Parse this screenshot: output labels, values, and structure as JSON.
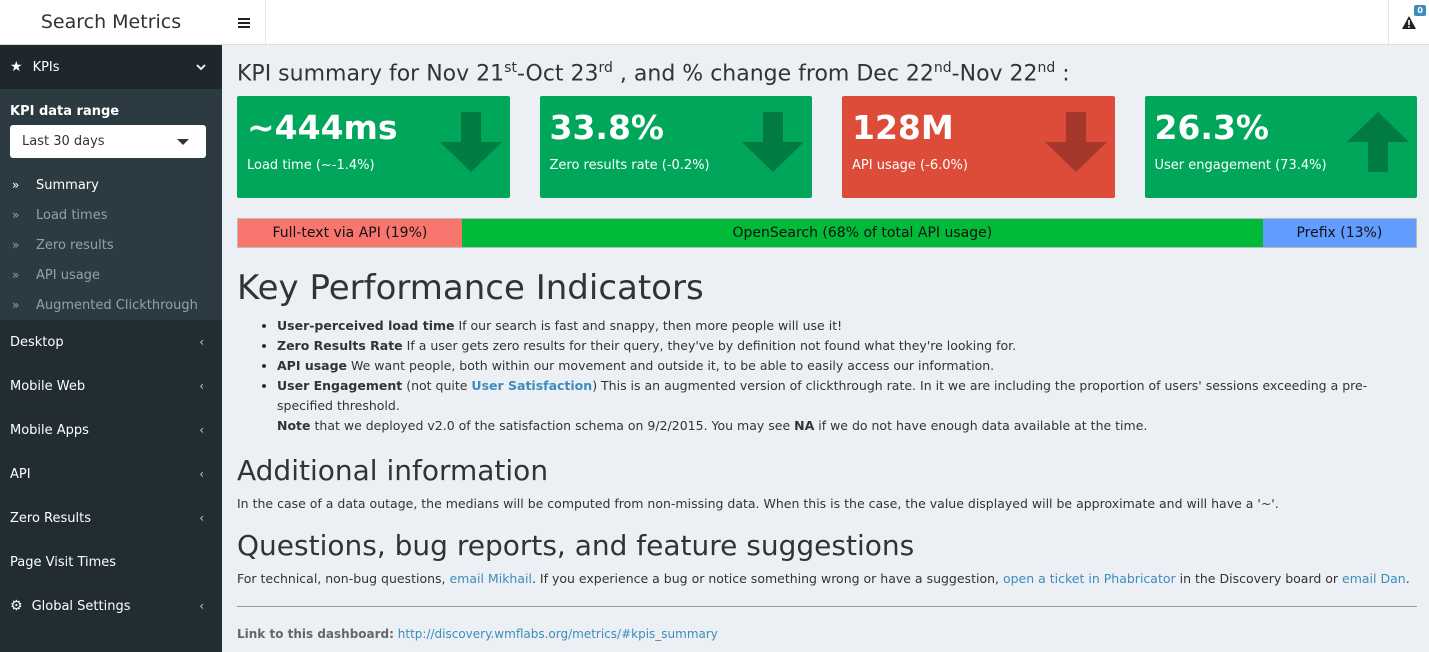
{
  "app": {
    "title": "Search Metrics"
  },
  "notifications": {
    "count": "0",
    "icon": "warning-icon"
  },
  "sidebar": {
    "kpis_label": "KPIs",
    "range_label": "KPI data range",
    "range_value": "Last 30 days",
    "sub_items": [
      {
        "label": "Summary",
        "active": true
      },
      {
        "label": "Load times"
      },
      {
        "label": "Zero results"
      },
      {
        "label": "API usage"
      },
      {
        "label": "Augmented Clickthrough"
      }
    ],
    "menu": [
      {
        "label": "Desktop"
      },
      {
        "label": "Mobile Web"
      },
      {
        "label": "Mobile Apps"
      },
      {
        "label": "API"
      },
      {
        "label": "Zero Results"
      },
      {
        "label": "Page Visit Times"
      },
      {
        "label": "Global Settings"
      }
    ]
  },
  "summary": {
    "t1": "KPI summary for Nov 21",
    "s1": "st",
    "t2": "-Oct 23",
    "s2": "rd",
    "t3": " , and % change from Dec 22",
    "s3": "nd",
    "t4": "-Nov 22",
    "s4": "nd",
    "t5": " :"
  },
  "boxes": [
    {
      "value": "~444ms",
      "label": "Load time (~-1.4%)",
      "color": "#00a65a",
      "arrow": "down"
    },
    {
      "value": "33.8%",
      "label": "Zero results rate (-0.2%)",
      "color": "#00a65a",
      "arrow": "down"
    },
    {
      "value": "128M",
      "label": "API usage (-6.0%)",
      "color": "#dd4b39",
      "arrow": "down"
    },
    {
      "value": "26.3%",
      "label": "User engagement (73.4%)",
      "color": "#00a65a",
      "arrow": "up"
    }
  ],
  "usage_bar": [
    {
      "label": "Full-text via API (19%)",
      "share": 19,
      "color": "#f8766d"
    },
    {
      "label": "OpenSearch (68% of total API usage)",
      "share": 68,
      "color": "#00ba38"
    },
    {
      "label": "Prefix (13%)",
      "share": 13,
      "color": "#619cff"
    }
  ],
  "kpi_section": {
    "heading": "Key Performance Indicators",
    "items": [
      {
        "term": "User-perceived load time",
        "desc": " If our search is fast and snappy, then more people will use it!"
      },
      {
        "term": "Zero Results Rate",
        "desc": " If a user gets zero results for their query, they've by definition not found what they're looking for."
      },
      {
        "term": "API usage",
        "desc": " We want people, both within our movement and outside it, to be able to easily access our information."
      }
    ],
    "engagement": {
      "term": "User Engagement",
      "pre": " (not quite ",
      "link": "User Satisfaction",
      "post": ") This is an augmented version of clickthrough rate. In it we are including the proportion of users' sessions exceeding a pre-specified threshold.",
      "note_term": "Note",
      "note": " that we deployed v2.0 of the satisfaction schema on 9/2/2015. You may see ",
      "na": "NA",
      "note_end": " if we do not have enough data available at the time."
    }
  },
  "additional": {
    "heading": "Additional information",
    "text": "In the case of a data outage, the medians will be computed from non-missing data. When this is the case, the value displayed will be approximate and will have a '~'."
  },
  "questions": {
    "heading": "Questions, bug reports, and feature suggestions",
    "p1": "For technical, non-bug questions, ",
    "link1": "email Mikhail",
    "p2": ". If you experience a bug or notice something wrong or have a suggestion, ",
    "link2": "open a ticket in Phabricator",
    "p3": " in the Discovery board or ",
    "link3": "email Dan",
    "p4": "."
  },
  "footer": {
    "label": "Link to this dashboard:",
    "url": "http://discovery.wmflabs.org/metrics/#kpis_summary"
  }
}
